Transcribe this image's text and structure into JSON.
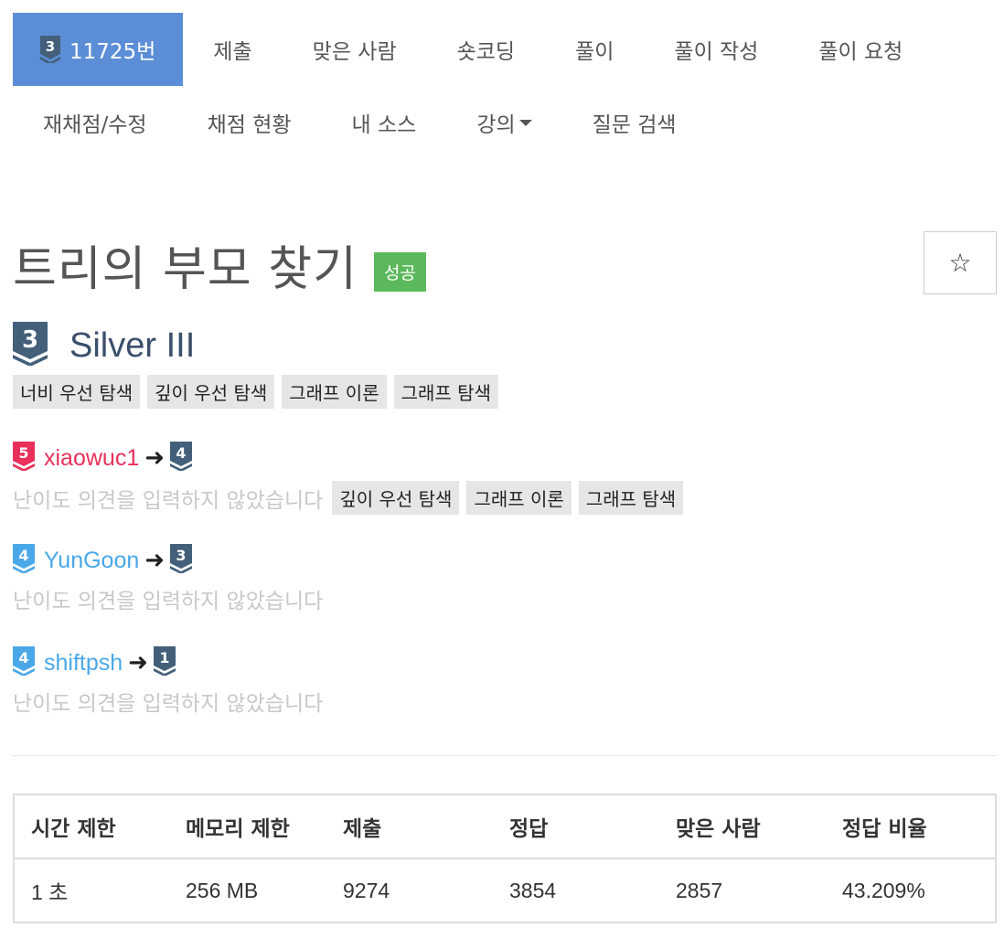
{
  "nav": {
    "row1": [
      {
        "label": "11725번",
        "active": true,
        "tier": "3"
      },
      {
        "label": "제출"
      },
      {
        "label": "맞은 사람"
      },
      {
        "label": "숏코딩"
      },
      {
        "label": "풀이"
      },
      {
        "label": "풀이 작성"
      },
      {
        "label": "풀이 요청"
      }
    ],
    "row2": [
      {
        "label": "재채점/수정"
      },
      {
        "label": "채점 현황"
      },
      {
        "label": "내 소스"
      },
      {
        "label": "강의"
      },
      {
        "label": "질문 검색"
      }
    ]
  },
  "problem": {
    "title": "트리의 부모 찾기",
    "result_label": "성공",
    "star_icon": "☆",
    "tier_number": "3",
    "tier_name": "Silver III",
    "tags": [
      "너비 우선 탐색",
      "깊이 우선 탐색",
      "그래프 이론",
      "그래프 탐색"
    ]
  },
  "opinions": [
    {
      "user": "xiaowuc1",
      "from_tier": "5",
      "to_tier": "4",
      "text": "난이도 의견을 입력하지 않았습니다",
      "tags": [
        "깊이 우선 탐색",
        "그래프 이론",
        "그래프 탐색"
      ],
      "user_color": "#e8305a"
    },
    {
      "user": "YunGoon",
      "from_tier": "4",
      "to_tier": "3",
      "text": "난이도 의견을 입력하지 않았습니다",
      "tags": [],
      "user_color": "#4aa8e8"
    },
    {
      "user": "shiftpsh",
      "from_tier": "4",
      "to_tier": "1",
      "text": "난이도 의견을 입력하지 않았습니다",
      "tags": [],
      "user_color": "#4aa8e8"
    }
  ],
  "info_table": {
    "headers": [
      "시간 제한",
      "메모리 제한",
      "제출",
      "정답",
      "맞은 사람",
      "정답 비율"
    ],
    "values": [
      "1 초",
      "256 MB",
      "9274",
      "3854",
      "2857",
      "43.209%"
    ]
  },
  "colors": {
    "nav_active": "#5b8ed6",
    "success": "#5cb85c",
    "silver_tier": "#435f7a",
    "bronze_tier": "#e8305a",
    "silver4_tier": "#4aa8e8"
  }
}
